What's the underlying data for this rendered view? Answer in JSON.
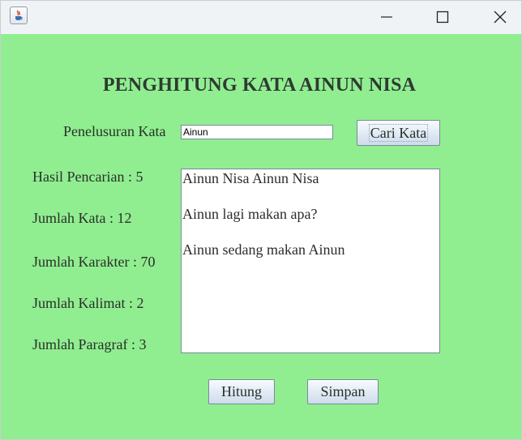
{
  "window": {
    "title": "",
    "icon": "java-cup-icon",
    "controls": [
      "minimize-icon",
      "maximize-icon",
      "close-icon"
    ]
  },
  "app": {
    "title": "PENGHITUNG KATA AINUN NISA",
    "background_color": "#90ee90"
  },
  "search": {
    "label": "Penelusuran Kata",
    "value": "Ainun",
    "button_label": "Cari Kata"
  },
  "stats": {
    "hasil_pencarian": "Hasil Pencarian : 5",
    "jumlah_kata": "Jumlah Kata : 12",
    "jumlah_karakter": "Jumlah Karakter : 70",
    "jumlah_kalimat": "Jumlah Kalimat : 2",
    "jumlah_paragraf": "Jumlah Paragraf : 3"
  },
  "text_area": {
    "lines": [
      "Ainun Nisa Ainun Nisa",
      "Ainun lagi makan apa?",
      "Ainun sedang makan Ainun"
    ]
  },
  "actions": {
    "hitung_label": "Hitung",
    "simpan_label": "Simpan"
  }
}
